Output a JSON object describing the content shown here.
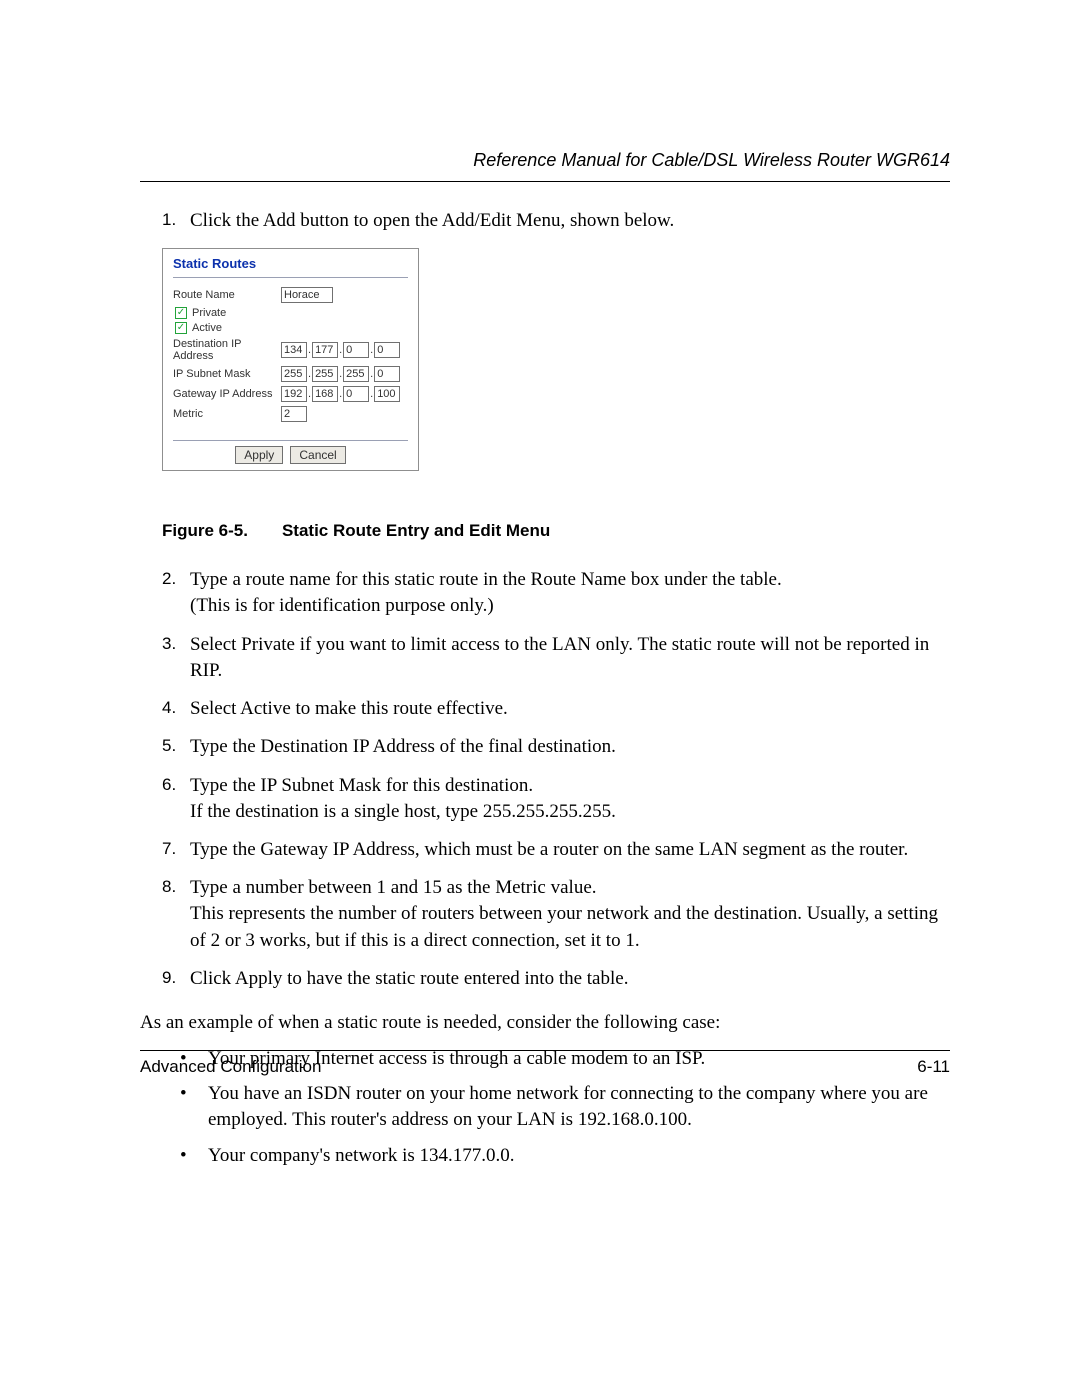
{
  "header": {
    "title": "Reference Manual for Cable/DSL Wireless Router WGR614"
  },
  "steps_before": {
    "num": "1.",
    "text": "Click the Add button to open the Add/Edit Menu, shown below."
  },
  "panel": {
    "title": "Static Routes",
    "route_name_label": "Route Name",
    "route_name_value": "Horace",
    "private_label": "Private",
    "active_label": "Active",
    "dest_label": "Destination IP Address",
    "mask_label": "IP Subnet Mask",
    "gw_label": "Gateway IP Address",
    "metric_label": "Metric",
    "dest": [
      "134",
      "177",
      "0",
      "0"
    ],
    "mask": [
      "255",
      "255",
      "255",
      "0"
    ],
    "gw": [
      "192",
      "168",
      "0",
      "100"
    ],
    "metric": "2",
    "apply": "Apply",
    "cancel": "Cancel"
  },
  "figure_caption": {
    "num": "Figure 6-5.",
    "text": "Static Route Entry and Edit Menu"
  },
  "steps_after": [
    {
      "num": "2.",
      "text": "Type a route name for this static route in the Route Name box under the table.\n(This is for identification purpose only.)"
    },
    {
      "num": "3.",
      "text": "Select Private if you want to limit access to the LAN only. The static route will not be reported in RIP."
    },
    {
      "num": "4.",
      "text": "Select Active to make this route effective."
    },
    {
      "num": "5.",
      "text": "Type the Destination IP Address of the final destination."
    },
    {
      "num": "6.",
      "text": "Type the IP Subnet Mask for this destination.\nIf the destination is a single host, type 255.255.255.255."
    },
    {
      "num": "7.",
      "text": "Type the Gateway IP Address, which must be a router on the same LAN segment as the router."
    },
    {
      "num": "8.",
      "text": "Type a number between 1 and 15 as the Metric value.\nThis represents the number of routers between your network and the destination. Usually, a setting of 2 or 3 works, but if this is a direct connection, set it to 1."
    },
    {
      "num": "9.",
      "text": "Click Apply to have the static route entered into the table."
    }
  ],
  "example_intro": "As an example of when a static route is needed, consider the following case:",
  "bullets": [
    "Your primary Internet access is through a cable modem to an ISP.",
    "You have an ISDN router on your home network for connecting to the company where you are employed. This router's address on your LAN is 192.168.0.100.",
    "Your company's network is 134.177.0.0."
  ],
  "footer": {
    "left": "Advanced Configuration",
    "right": "6-11"
  }
}
